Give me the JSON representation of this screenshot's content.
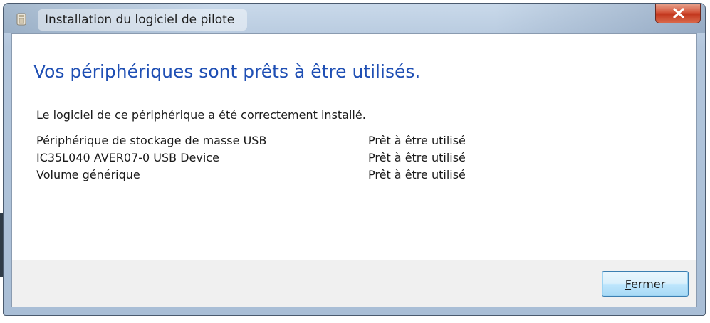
{
  "window": {
    "title": "Installation du logiciel de pilote",
    "icon": "driver-install-icon",
    "close_icon": "close-icon"
  },
  "content": {
    "heading": "Vos périphériques sont prêts à être utilisés.",
    "summary": "Le logiciel de ce périphérique a été correctement installé.",
    "devices": [
      {
        "name": "Périphérique de stockage de masse USB",
        "status": "Prêt à être utilisé"
      },
      {
        "name": "IC35L040 AVER07-0 USB Device",
        "status": "Prêt à être utilisé"
      },
      {
        "name": "Volume générique",
        "status": "Prêt à être utilisé"
      }
    ]
  },
  "footer": {
    "close_button": {
      "mnemonic": "F",
      "rest": "ermer"
    }
  },
  "colors": {
    "heading": "#1f4fb4",
    "close_button_red": "#c2361d",
    "button_blue_border": "#3c7fb1"
  }
}
